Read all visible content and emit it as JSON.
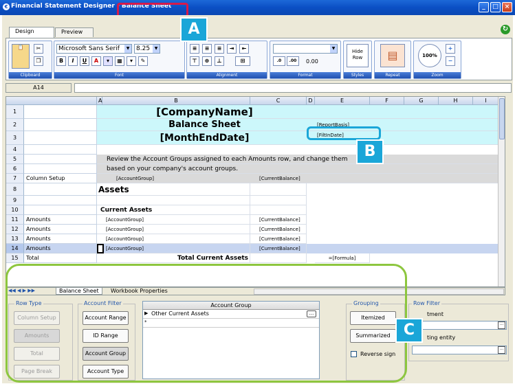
{
  "window": {
    "title": "Financial Statement Designer - Balance Sheet",
    "controls": [
      "_",
      "□",
      "×"
    ]
  },
  "tabs": [
    "Design",
    "Preview"
  ],
  "ribbon": {
    "font_name": "Microsoft Sans Serif",
    "font_size": "8.25",
    "bold": "B",
    "italic": "I",
    "underline": "U",
    "fontcolor": "A",
    "number_value": "0.00",
    "hide_row": "Hide Row",
    "zoom_value": "100%",
    "groups": [
      "Clipboard",
      "Font",
      "Alignment",
      "Format",
      "Styles",
      "Repeat",
      "Zoom"
    ]
  },
  "cell_ref": "A14",
  "columns": [
    "A",
    "B",
    "C",
    "D",
    "E",
    "F",
    "G",
    "H",
    "I"
  ],
  "rows": [
    {
      "n": "1",
      "a": "",
      "b": "[CompanyName]",
      "c": "",
      "e": ""
    },
    {
      "n": "2",
      "a": "",
      "b": "Balance Sheet",
      "c": "",
      "e": "[ReportBasis]"
    },
    {
      "n": "3",
      "a": "",
      "b": "[MonthEndDate]",
      "c": "",
      "e": "[FiltInDate]"
    },
    {
      "n": "4",
      "a": "",
      "b": "",
      "c": "",
      "e": ""
    },
    {
      "n": "5",
      "a": "",
      "b": "Review the Account Groups assigned to each Amounts row, and change them",
      "c": "",
      "e": ""
    },
    {
      "n": "6",
      "a": "",
      "b": "based on your company's account groups.",
      "c": "",
      "e": ""
    },
    {
      "n": "7",
      "a": "Column Setup",
      "b": "[AccountGroup]",
      "c": "[CurrentBalance]",
      "e": ""
    },
    {
      "n": "8",
      "a": "",
      "b": "Assets",
      "c": "",
      "e": ""
    },
    {
      "n": "9",
      "a": "",
      "b": "",
      "c": "",
      "e": ""
    },
    {
      "n": "10",
      "a": "",
      "b": "Current Assets",
      "c": "",
      "e": ""
    },
    {
      "n": "11",
      "a": "Amounts",
      "b": "[AccountGroup]",
      "c": "[CurrentBalance]",
      "e": ""
    },
    {
      "n": "12",
      "a": "Amounts",
      "b": "[AccountGroup]",
      "c": "[CurrentBalance]",
      "e": ""
    },
    {
      "n": "13",
      "a": "Amounts",
      "b": "[AccountGroup]",
      "c": "[CurrentBalance]",
      "e": ""
    },
    {
      "n": "14",
      "a": "Amounts",
      "b": "[AccountGroup]",
      "c": "[CurrentBalance]",
      "e": ""
    },
    {
      "n": "15",
      "a": "Total",
      "b": "Total Current Assets",
      "c": "",
      "e": "=[Formula]"
    }
  ],
  "sheet_tabs": [
    "Balance Sheet",
    "Workbook Properties"
  ],
  "row_type": {
    "legend": "Row Type",
    "buttons": [
      "Column Setup",
      "Amounts",
      "Total",
      "Page Break"
    ]
  },
  "account_filter": {
    "legend": "Account Filter",
    "buttons": [
      "Account Range",
      "ID Range",
      "Account Group",
      "Account Type"
    ]
  },
  "account_group_table": {
    "header": "Account Group",
    "rows": [
      "Other Current Assets",
      ""
    ]
  },
  "grouping": {
    "legend": "Grouping",
    "buttons": [
      "Itemized",
      "Summarized"
    ],
    "checkbox": "Reverse sign"
  },
  "row_filter": {
    "legend": "Row Filter",
    "field1_label": "tment",
    "field2_label": "ting entity"
  },
  "callouts": [
    "A",
    "B",
    "C"
  ],
  "colors": {
    "callout": "#1aa6d8",
    "highlight_red": "#d61a4a",
    "highlight_green": "#8dc63f",
    "title_blue": "#0b4fc4"
  }
}
